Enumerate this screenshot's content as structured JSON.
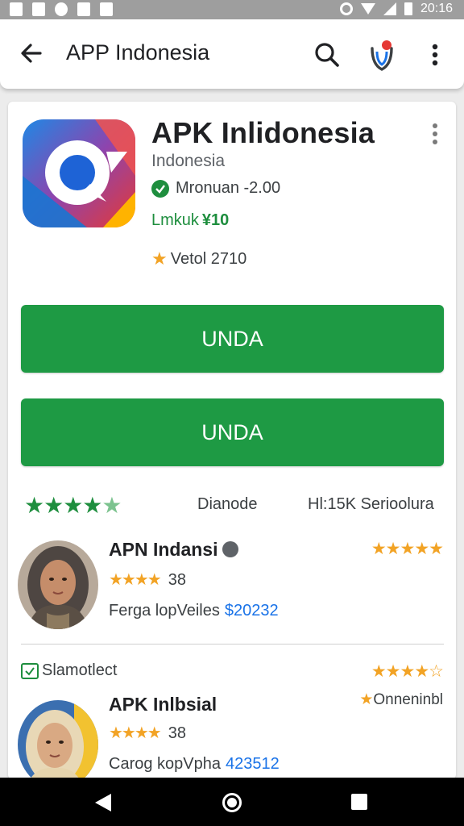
{
  "status_bar": {
    "time": "20:16",
    "left_icons": [
      "notification-icon",
      "image-icon",
      "chat-icon",
      "gallery-icon",
      "alert-icon"
    ],
    "right_icons": [
      "alarm-icon",
      "wifi-icon",
      "signal-icon",
      "battery-icon"
    ]
  },
  "toolbar": {
    "title": "APP Indonesia",
    "back_icon": "arrow-left-icon",
    "search_icon": "search-icon",
    "shield_icon": "shield-icon",
    "more_icon": "more-vert-icon"
  },
  "app": {
    "name": "APK Inlidonesia",
    "developer": "Indonesia",
    "verified_text": "Mronuan -2.00",
    "green_label": "Lmkuk",
    "green_value": "¥10",
    "rating_text": "Vetol 2710"
  },
  "buttons": {
    "primary_label": "UNDA",
    "secondary_label": "UNDA"
  },
  "summary": {
    "stars": "★★★★",
    "half_star": "★",
    "middle_text": "Dianode",
    "right_text": "Hl:15K Serioolura"
  },
  "reviews": [
    {
      "name": "APN Indansi",
      "top_stars": "★★★★★",
      "stars": "★★★★",
      "score": "38",
      "meta_text": "Ferga lopVeiles",
      "meta_number": "$20232"
    },
    {
      "support_text": "Slamotlect",
      "top_stars": "★★★★☆",
      "side_label": "Onneninbl",
      "name": "APK Inlbsial",
      "stars": "★★★★",
      "score": "38",
      "meta_text": "Carog kopVpha",
      "meta_number": "423512"
    }
  ],
  "colors": {
    "accent_green": "#1e9a44",
    "star_gold": "#f2a325",
    "link_blue": "#1a73e8",
    "status_bar": "#9e9e9e"
  }
}
